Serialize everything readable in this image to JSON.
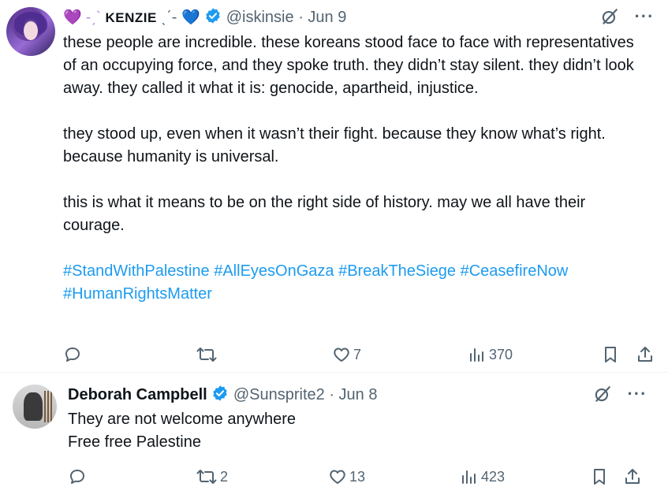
{
  "tweets": [
    {
      "avatar_icon": "anime-avatar",
      "name_prefix": "💜 -ˏˋ",
      "display_name": "KENZIE",
      "name_suffix": "ˎˊ-",
      "name_heart": "💙",
      "handle": "@iskinsie",
      "date": "· Jun 9",
      "paragraphs": [
        "these people are incredible. these koreans stood face to face with representatives of an occupying force, and they spoke truth. they didn’t stay silent. they didn’t look away. they called it what it is: genocide, apartheid, injustice.",
        "they stood up, even when it wasn’t their fight. because they know what’s right. because humanity is universal.",
        "this is what it means to be on the right side of history. may we all have their courage."
      ],
      "hashtags_line1": "#StandWithPalestine #AllEyesOnGaza #BreakTheSiege #CeasefireNow",
      "hashtags_line2": "#HumanRightsMatter",
      "reply_count": "",
      "retweet_count": "",
      "like_count": "7",
      "view_count": "370"
    },
    {
      "avatar_icon": "cat-avatar",
      "display_name": "Deborah Campbell",
      "handle": "@Sunsprite2",
      "date": "· Jun 8",
      "line1": "They are not welcome anywhere",
      "line2": "Free free Palestine",
      "reply_count": "",
      "retweet_count": "2",
      "like_count": "13",
      "view_count": "423"
    }
  ],
  "colors": {
    "text": "#0f1419",
    "secondary": "#536471",
    "link": "#1d9bf0",
    "verified": "#1d9bf0"
  }
}
